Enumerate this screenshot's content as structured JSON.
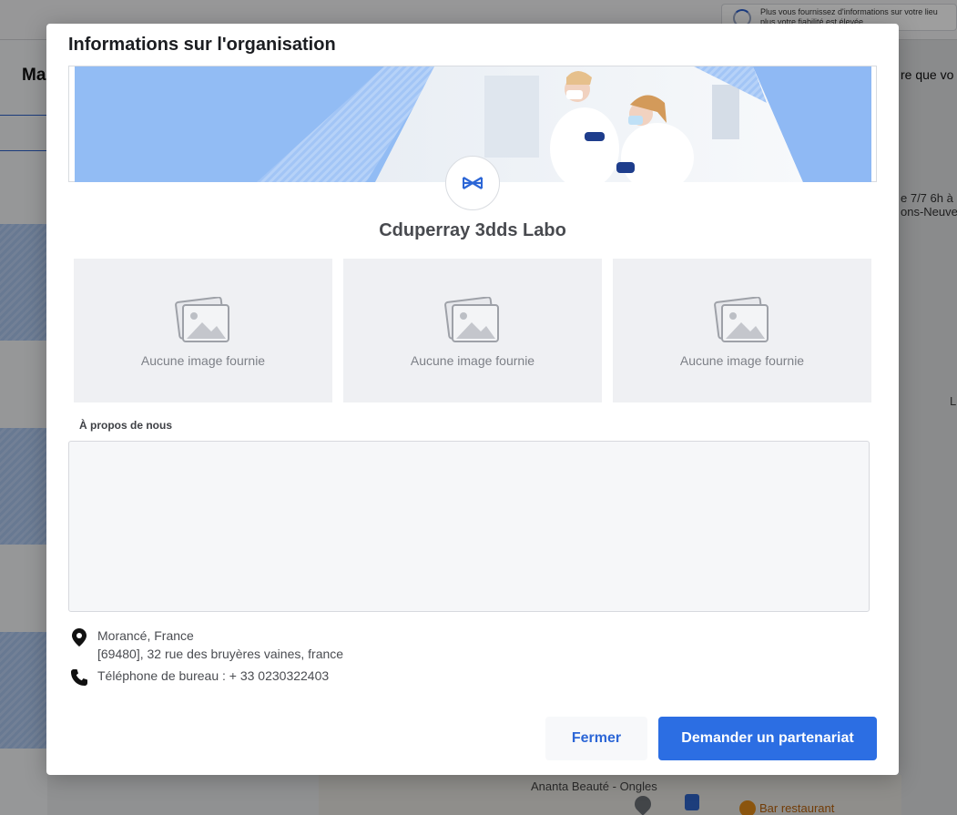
{
  "background": {
    "page_heading": "Ma",
    "notice_line1": "Plus vous fournissez d'informations sur votre lieu",
    "notice_line2": "plus votre fiabilité est élevée",
    "right_text": "re que vo",
    "right_text2_line1": "e 7/7 6h à",
    "right_text2_line2": "ons-Neuve",
    "right_text3": "L",
    "map_label_beauty": "Ananta Beauté - Ongles",
    "map_label_bar": "Bar restaurant"
  },
  "modal": {
    "title": "Informations sur l'organisation",
    "organization_name": "Cduperray 3dds Labo",
    "gallery": [
      {
        "label": "Aucune image fournie",
        "icon": "image-placeholder-icon"
      },
      {
        "label": "Aucune image fournie",
        "icon": "image-placeholder-icon"
      },
      {
        "label": "Aucune image fournie",
        "icon": "image-placeholder-icon"
      }
    ],
    "about": {
      "label": "À propos de nous",
      "value": ""
    },
    "location": {
      "icon": "map-pin-icon",
      "city": "Morancé, France",
      "address": "[69480], 32 rue des bruyères vaines, france"
    },
    "phone": {
      "icon": "phone-icon",
      "text": "Téléphone de bureau : + 33 0230322403"
    },
    "buttons": {
      "close_label": "Fermer",
      "primary_label": "Demander un partenariat"
    }
  },
  "colors": {
    "primary": "#2c6ee3",
    "banner_blue": "#8db8f4",
    "overlay": "rgba(0,0,0,0.38)"
  }
}
